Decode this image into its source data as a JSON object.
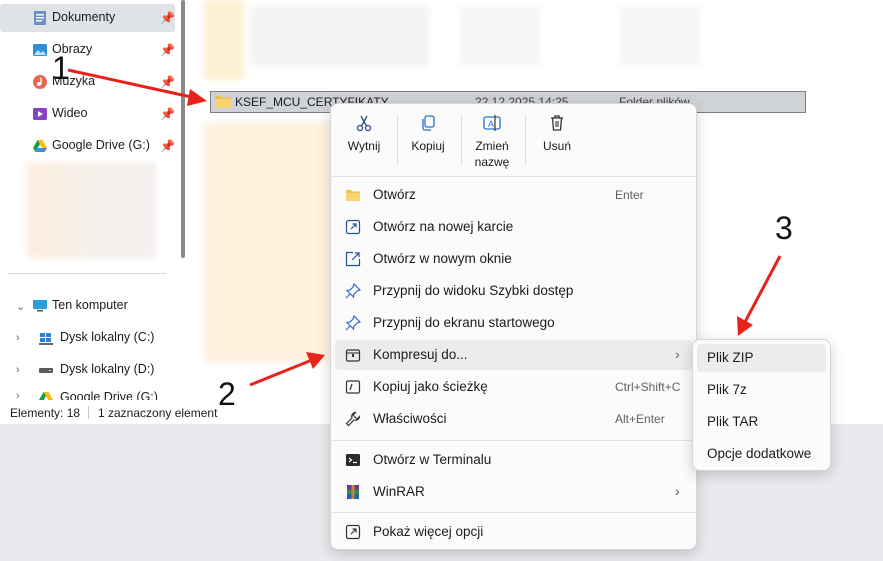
{
  "sidebar": {
    "quick_access": [
      {
        "label": "Dokumenty",
        "icon": "documents-icon"
      },
      {
        "label": "Obrazy",
        "icon": "pictures-icon"
      },
      {
        "label": "Muzyka",
        "icon": "music-icon"
      },
      {
        "label": "Wideo",
        "icon": "video-icon"
      },
      {
        "label": "Google Drive (G:)",
        "icon": "google-drive-icon"
      }
    ],
    "this_pc": "Ten komputer",
    "drives": [
      "Dysk lokalny (C:)",
      "Dysk lokalny (D:)",
      "Google Drive (G:)"
    ]
  },
  "file_row": {
    "name": "KSEF_MCU_CERTYFIKATY",
    "date": "22.12.2025 14:25",
    "type": "Folder plików"
  },
  "status": {
    "count": "Elementy: 18",
    "selection": "1 zaznaczony element"
  },
  "context_menu": {
    "quick_actions": [
      {
        "label": "Wytnij",
        "icon": "cut-icon"
      },
      {
        "label": "Kopiuj",
        "icon": "copy-icon"
      },
      {
        "label": "Zmień nazwę",
        "icon": "rename-icon"
      },
      {
        "label": "Usuń",
        "icon": "delete-icon"
      }
    ],
    "items": [
      {
        "label": "Otwórz",
        "shortcut": "Enter"
      },
      {
        "label": "Otwórz na nowej karcie",
        "shortcut": ""
      },
      {
        "label": "Otwórz w nowym oknie",
        "shortcut": ""
      },
      {
        "label": "Przypnij do widoku Szybki dostęp",
        "shortcut": ""
      },
      {
        "label": "Przypnij do ekranu startowego",
        "shortcut": ""
      },
      {
        "label": "Kompresuj do...",
        "shortcut": ""
      },
      {
        "label": "Kopiuj jako ścieżkę",
        "shortcut": "Ctrl+Shift+C"
      },
      {
        "label": "Właściwości",
        "shortcut": "Alt+Enter"
      },
      {
        "label": "Otwórz w Terminalu",
        "shortcut": ""
      },
      {
        "label": "WinRAR",
        "shortcut": ""
      },
      {
        "label": "Pokaż więcej opcji",
        "shortcut": ""
      }
    ]
  },
  "submenu": {
    "items": [
      "Plik ZIP",
      "Plik 7z",
      "Plik TAR",
      "Opcje dodatkowe"
    ]
  },
  "annotations": [
    "1",
    "2",
    "3"
  ],
  "colors": {
    "accent_arrow": "#e8231c",
    "folder": "#f3c14b",
    "hover": "#ececec"
  }
}
